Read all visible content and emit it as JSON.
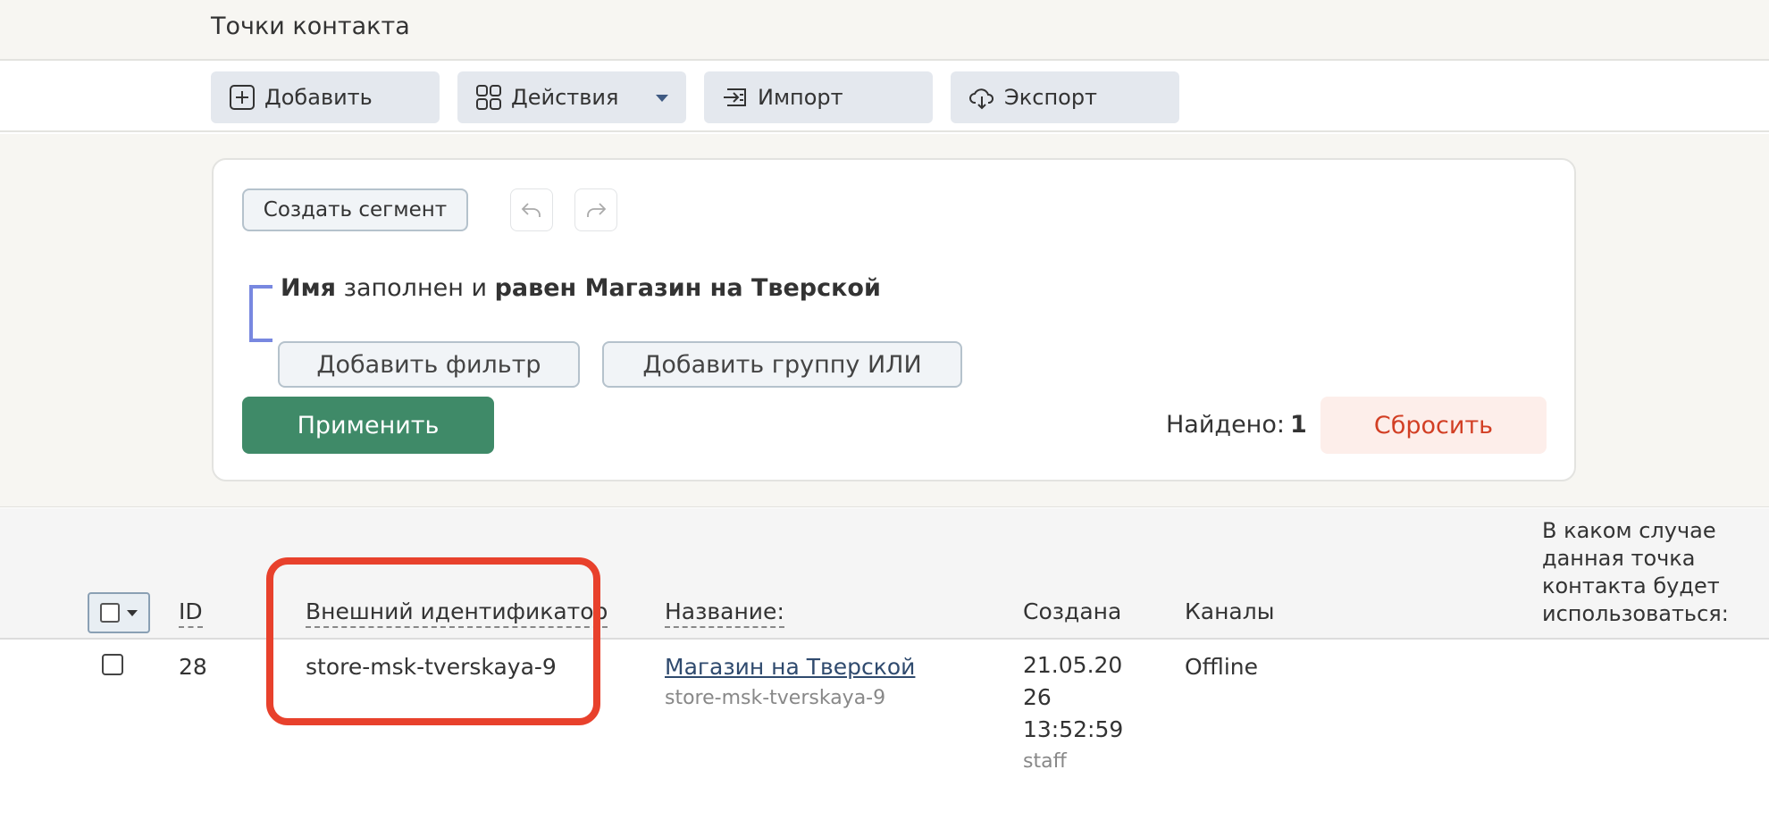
{
  "header": {
    "title": "Точки контакта"
  },
  "toolbar": {
    "add_label": "Добавить",
    "actions_label": "Действия",
    "import_label": "Импорт",
    "export_label": "Экспорт"
  },
  "filter": {
    "create_segment_label": "Создать сегмент",
    "condition": {
      "field": "Имя",
      "operator": "заполнен и",
      "comparison": "равен Магазин на Тверской"
    },
    "add_filter_label": "Добавить фильтр",
    "add_group_label": "Добавить группу ИЛИ",
    "apply_label": "Применить",
    "found_label": "Найдено:",
    "found_count": "1",
    "reset_label": "Сбросить"
  },
  "table": {
    "columns": {
      "id": "ID",
      "external_id": "Внешний идентификатор",
      "name": "Название:",
      "created": "Создана",
      "channels": "Каналы",
      "usage": "В каком случае данная точка контакта будет использоваться:"
    },
    "rows": [
      {
        "id": "28",
        "external_id": "store-msk-tverskaya-9",
        "name": "Магазин на Тверской",
        "name_sub": "store-msk-tverskaya-9",
        "created_line1": "21.05.20",
        "created_line2": "26",
        "created_line3": "13:52:59",
        "created_by": "staff",
        "channels": "Offline",
        "usage": ""
      }
    ]
  },
  "colors": {
    "apply": "#3f8a68",
    "reset_text": "#d23f24",
    "highlight": "#e8412c",
    "bracket": "#7888e0"
  }
}
